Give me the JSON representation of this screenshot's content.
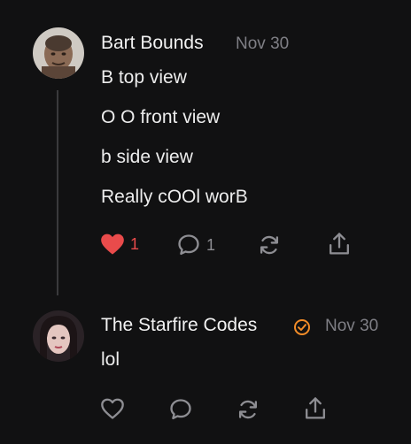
{
  "colors": {
    "background": "#111112",
    "liked": "#e94b4b",
    "icon": "#8e8e93",
    "verified": "#f28c28"
  },
  "comments": [
    {
      "author": "Bart Bounds",
      "date": "Nov 30",
      "lines": [
        "B top view",
        "O O front view",
        "b side view",
        "Really cOOl worB"
      ],
      "likes": "1",
      "replies": "1",
      "liked": true,
      "icons": [
        "heart-icon",
        "comment-icon",
        "restack-icon",
        "share-icon"
      ]
    },
    {
      "author": "The Starfire Codes",
      "verified_icon": "verified-check-icon",
      "date": "Nov 30",
      "lines": [
        "lol"
      ],
      "liked": false,
      "icons": [
        "heart-icon",
        "comment-icon",
        "restack-icon",
        "share-icon"
      ]
    }
  ]
}
